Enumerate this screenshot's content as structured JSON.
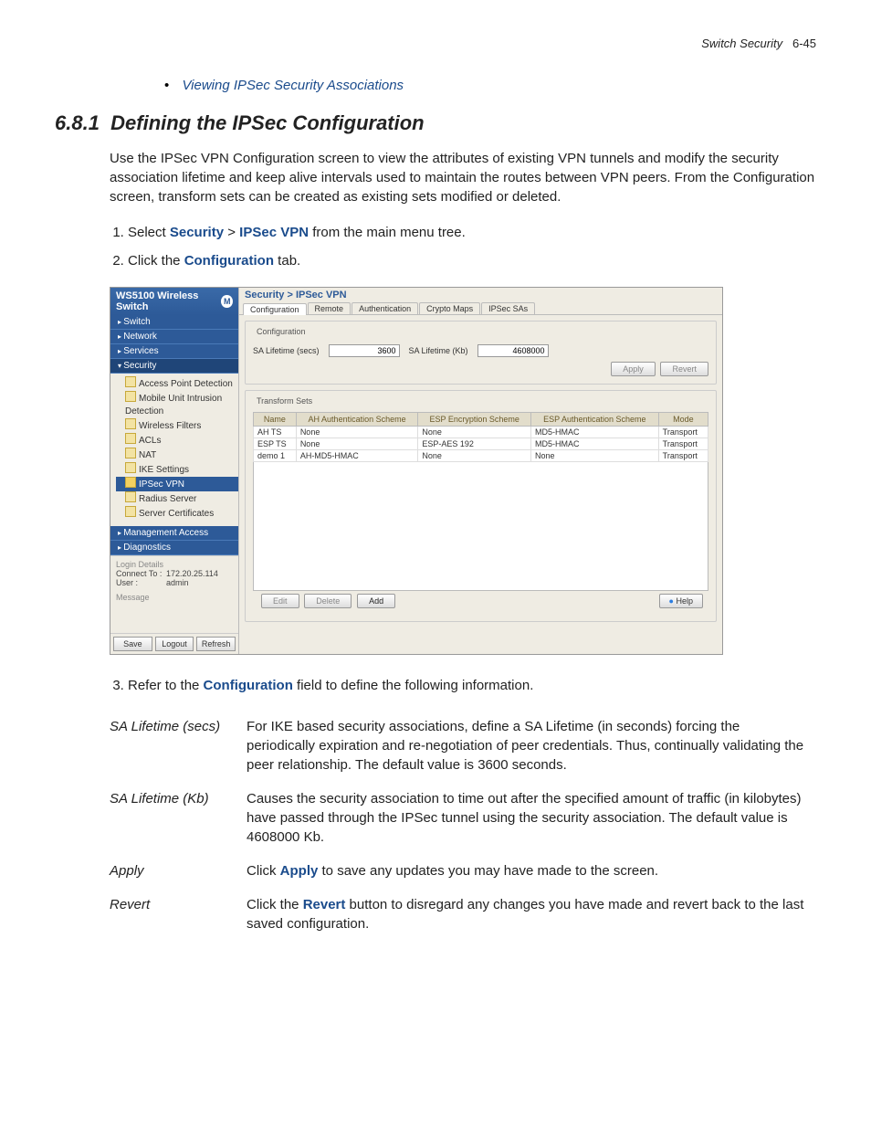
{
  "header": {
    "chapter": "Switch Security",
    "page": "6-45"
  },
  "link": "Viewing IPSec Security Associations",
  "section": {
    "num": "6.8.1",
    "title": "Defining the IPSec Configuration"
  },
  "intro": "Use the IPSec VPN Configuration screen to view the attributes of existing VPN tunnels and modify the security association lifetime and keep alive intervals used to maintain the routes between VPN peers. From the Configuration screen, transform sets can be created as existing sets modified or deleted.",
  "steps": {
    "s1a": "Select ",
    "s1b": "Security",
    "s1c": " > ",
    "s1d": "IPSec VPN",
    "s1e": " from the main menu tree.",
    "s2a": "Click the ",
    "s2b": "Configuration",
    "s2c": " tab.",
    "s3a": "Refer to the ",
    "s3b": "Configuration",
    "s3c": " field to define the following information."
  },
  "shot": {
    "product": "WS5100 Wireless Switch",
    "nav": [
      "Switch",
      "Network",
      "Services",
      "Security",
      "Management Access",
      "Diagnostics"
    ],
    "tree": [
      "Access Point Detection",
      "Mobile Unit Intrusion Detection",
      "Wireless Filters",
      "ACLs",
      "NAT",
      "IKE Settings",
      "IPSec VPN",
      "Radius Server",
      "Server Certificates"
    ],
    "login": {
      "title": "Login Details",
      "connect_lbl": "Connect To :",
      "connect": "172.20.25.114",
      "user_lbl": "User :",
      "user": "admin",
      "msg": "Message"
    },
    "footer_btns": [
      "Save",
      "Logout",
      "Refresh"
    ],
    "crumb": "Security > IPSec VPN",
    "tabs": [
      "Configuration",
      "Remote",
      "Authentication",
      "Crypto Maps",
      "IPSec SAs"
    ],
    "cfg": {
      "legend": "Configuration",
      "sa_secs_lbl": "SA Lifetime (secs)",
      "sa_secs": "3600",
      "sa_kb_lbl": "SA Lifetime (Kb)",
      "sa_kb": "4608000",
      "apply": "Apply",
      "revert": "Revert"
    },
    "ts": {
      "legend": "Transform Sets",
      "cols": [
        "Name",
        "AH Authentication Scheme",
        "ESP Encryption Scheme",
        "ESP Authentication Scheme",
        "Mode"
      ],
      "rows": [
        [
          "AH TS",
          "None",
          "None",
          "MD5-HMAC",
          "Transport"
        ],
        [
          "ESP TS",
          "None",
          "ESP-AES 192",
          "MD5-HMAC",
          "Transport"
        ],
        [
          "demo 1",
          "AH-MD5-HMAC",
          "None",
          "None",
          "Transport"
        ]
      ],
      "edit": "Edit",
      "delete": "Delete",
      "add": "Add",
      "help": "Help"
    }
  },
  "defs": [
    {
      "term": "SA Lifetime (secs)",
      "desc": "For IKE based security associations, define a SA Lifetime (in seconds) forcing the periodically expiration and re-negotiation of peer credentials. Thus, continually validating the peer relationship. The default value is 3600 seconds."
    },
    {
      "term": "SA Lifetime (Kb)",
      "desc": "Causes the security association to time out after the specified amount of traffic (in kilobytes) have passed through the IPSec tunnel using the security association. The default value is 4608000 Kb."
    },
    {
      "term": "Apply",
      "kw": "Apply",
      "pre": "Click ",
      "post": " to save any updates you may have made to the screen."
    },
    {
      "term": "Revert",
      "kw": "Revert",
      "pre": "Click the ",
      "post": " button to disregard any changes you have made and revert back to the last saved configuration."
    }
  ]
}
